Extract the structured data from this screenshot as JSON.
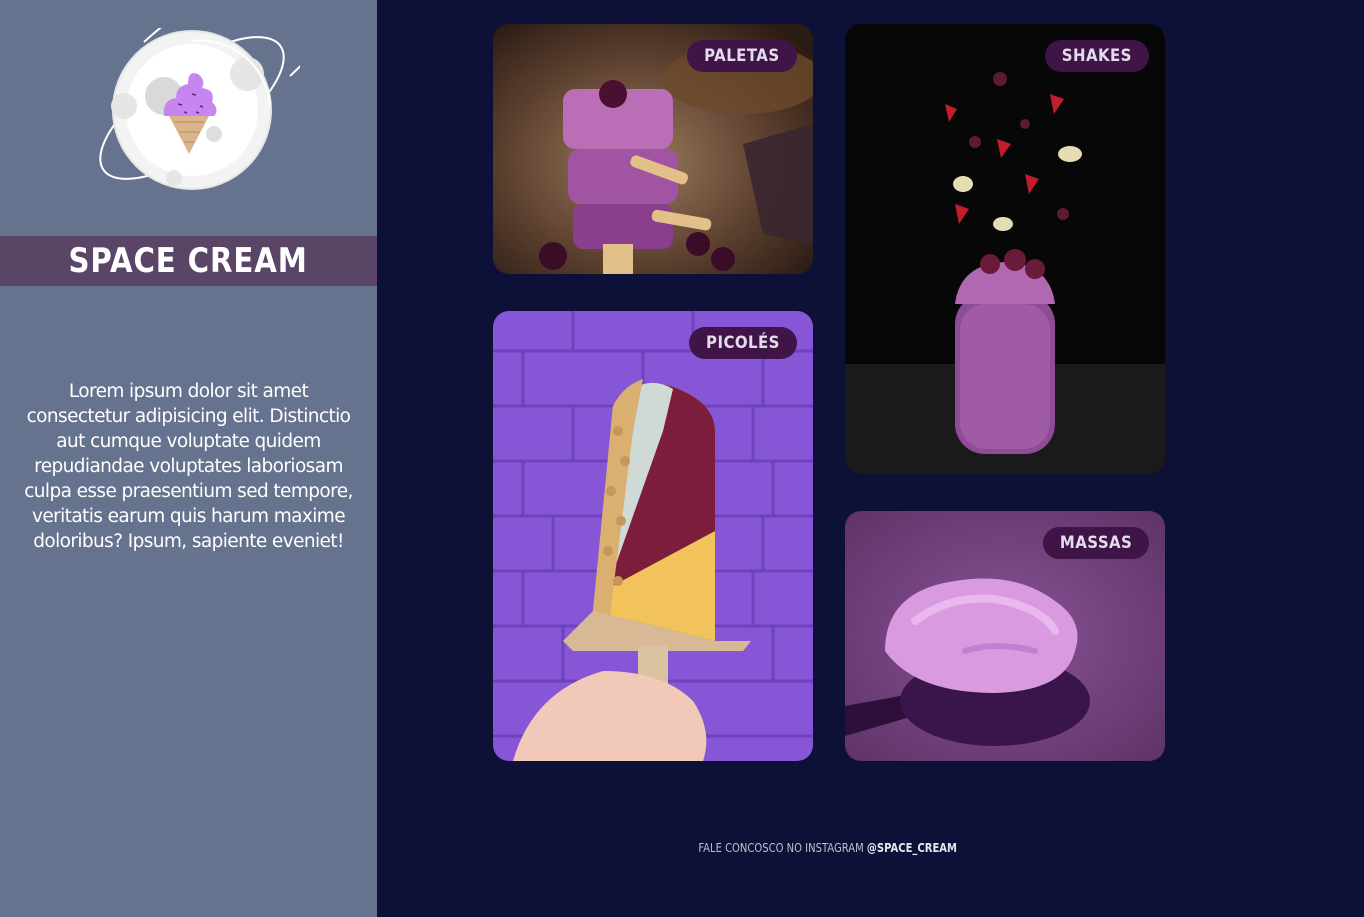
{
  "sidebar": {
    "brand": "Space Cream",
    "description": "Lorem ipsum dolor sit amet consectetur adipisicing elit. Distinctio aut cumque voluptate quidem repudiandae voluptates laboriosam culpa esse praesentium sed tempore, veritatis earum quis harum maxime doloribus? Ipsum, sapiente eveniet!"
  },
  "cards": [
    {
      "label": "Paletas",
      "icon": "popsicle-photo"
    },
    {
      "label": "Picolés",
      "icon": "ice-pop-photo"
    },
    {
      "label": "Shakes",
      "icon": "milkshake-photo"
    },
    {
      "label": "Massas",
      "icon": "ice-cream-scoop-photo"
    }
  ],
  "footer": {
    "text": "Fale concosco no instagram",
    "handle": "@space_cream"
  },
  "colors": {
    "background": "#0d1137",
    "sidebar": "#65738f",
    "brand_bar": "#5b4566",
    "badge": "#3f1447"
  }
}
